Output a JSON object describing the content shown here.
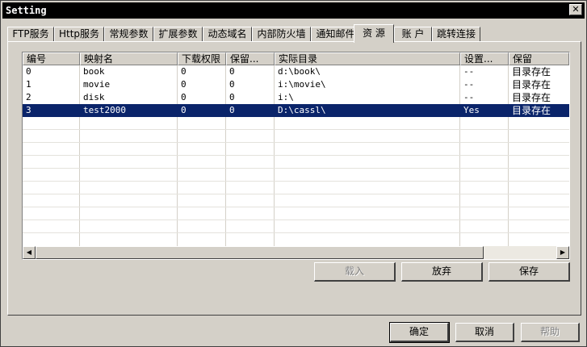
{
  "window": {
    "title": "Setting",
    "close_glyph": "✕"
  },
  "tabs": [
    {
      "label": "FTP服务"
    },
    {
      "label": "Http服务"
    },
    {
      "label": "常规参数"
    },
    {
      "label": "扩展参数"
    },
    {
      "label": "动态域名"
    },
    {
      "label": "内部防火墙"
    },
    {
      "label": "通知邮件"
    },
    {
      "label": "资 源",
      "active": true
    },
    {
      "label": "账 户"
    },
    {
      "label": "跳转连接"
    }
  ],
  "table": {
    "columns": [
      "编号",
      "映射名",
      "下载权限",
      "保留...",
      "实际目录",
      "设置...",
      "保留"
    ],
    "rows": [
      [
        "0",
        "book",
        "0",
        "0",
        "d:\\book\\",
        "--",
        "目录存在"
      ],
      [
        "1",
        "movie",
        "0",
        "0",
        "i:\\movie\\",
        "--",
        "目录存在"
      ],
      [
        "2",
        "disk",
        "0",
        "0",
        "i:\\",
        "--",
        "目录存在"
      ],
      [
        "3",
        "test2000",
        "0",
        "0",
        "D:\\cassl\\",
        "Yes",
        "目录存在"
      ]
    ],
    "selected_row": 3,
    "selection_color": "#0a246a"
  },
  "scrollbar": {
    "left_glyph": "◀",
    "right_glyph": "▶"
  },
  "panel_buttons": {
    "load": "载入",
    "discard": "放弃",
    "save": "保存"
  },
  "dialog_buttons": {
    "ok": "确定",
    "cancel": "取消",
    "help": "帮助"
  }
}
